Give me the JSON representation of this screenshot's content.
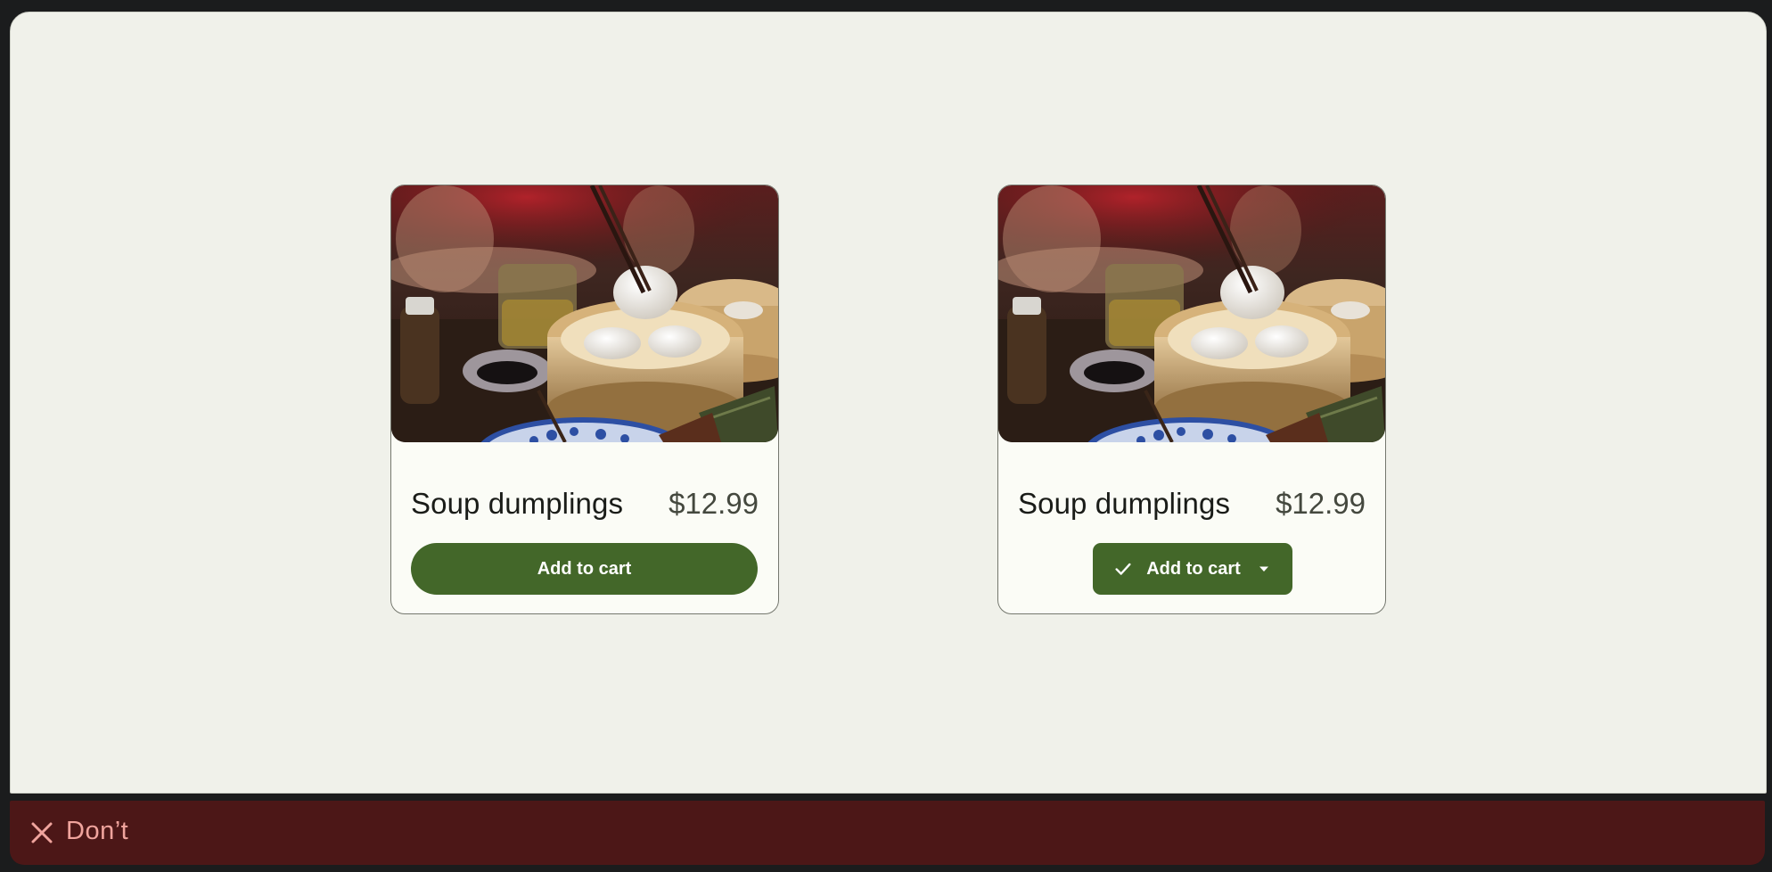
{
  "cards": [
    {
      "title": "Soup dumplings",
      "price": "$12.99",
      "button_label": "Add to cart",
      "button_style": "full-width pill"
    },
    {
      "title": "Soup dumplings",
      "price": "$12.99",
      "button_label": "Add to cart",
      "button_style": "split button with check icon and dropdown caret"
    }
  ],
  "banner": {
    "label": "Don’t",
    "icon": "close-icon"
  },
  "colors": {
    "background": "#f0f1ea",
    "card_surface": "#fbfcf6",
    "card_outline": "#74776e",
    "primary_button": "#436729",
    "on_primary": "#ffffff",
    "banner_background": "#4c1717",
    "banner_text": "#f0a49d"
  }
}
